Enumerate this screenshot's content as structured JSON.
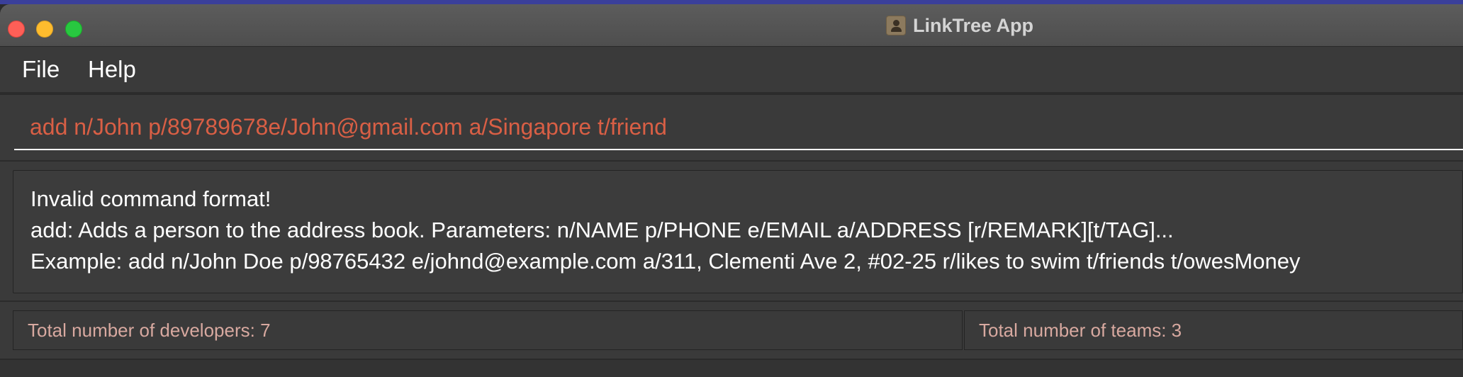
{
  "window": {
    "title": "LinkTree App",
    "icon": "app-icon"
  },
  "menu": {
    "items": [
      {
        "label": "File"
      },
      {
        "label": "Help"
      }
    ]
  },
  "command": {
    "value": "add n/John p/89789678e/John@gmail.com a/Singapore t/friend",
    "text_color": "#d95f45"
  },
  "result": {
    "lines": [
      "Invalid command format!",
      "add: Adds a person to the address book. Parameters: n/NAME p/PHONE e/EMAIL a/ADDRESS [r/REMARK][t/TAG]...",
      "Example: add n/John Doe p/98765432 e/johnd@example.com a/311, Clementi Ave 2, #02-25 r/likes to swim t/friends t/owesMoney"
    ]
  },
  "status": {
    "developers": "Total number of developers: 7",
    "teams": "Total number of teams: 3"
  },
  "colors": {
    "background": "#2b2b2b",
    "panel": "#3a3a3a",
    "status_text": "#d8a9a0",
    "close": "#fe5f57",
    "minimize": "#febc2e",
    "maximize": "#28c840"
  }
}
